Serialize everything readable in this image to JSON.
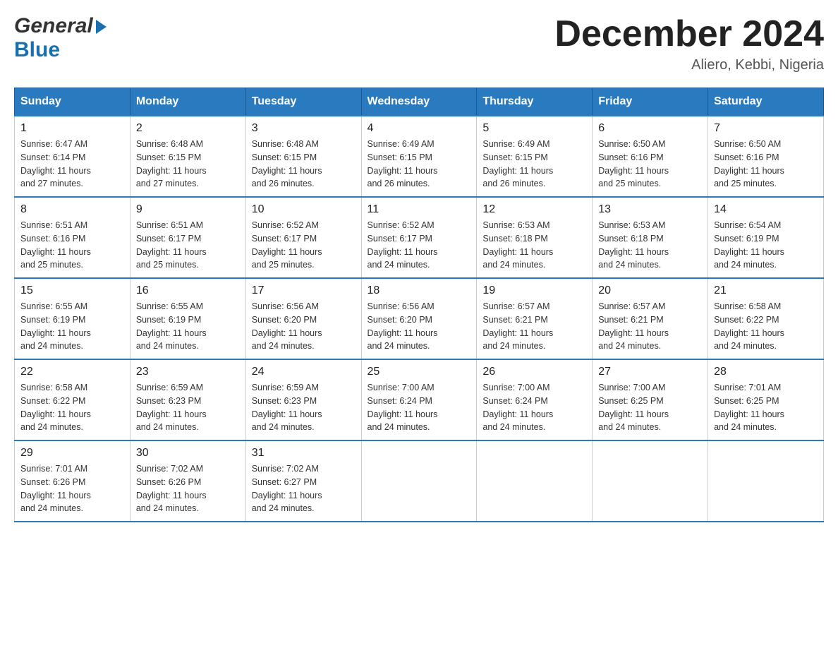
{
  "header": {
    "logo": {
      "general": "General",
      "blue": "Blue",
      "arrow": "▶"
    },
    "title": "December 2024",
    "location": "Aliero, Kebbi, Nigeria"
  },
  "weekdays": [
    "Sunday",
    "Monday",
    "Tuesday",
    "Wednesday",
    "Thursday",
    "Friday",
    "Saturday"
  ],
  "weeks": [
    [
      {
        "day": "1",
        "sunrise": "6:47 AM",
        "sunset": "6:14 PM",
        "daylight": "11 hours and 27 minutes."
      },
      {
        "day": "2",
        "sunrise": "6:48 AM",
        "sunset": "6:15 PM",
        "daylight": "11 hours and 27 minutes."
      },
      {
        "day": "3",
        "sunrise": "6:48 AM",
        "sunset": "6:15 PM",
        "daylight": "11 hours and 26 minutes."
      },
      {
        "day": "4",
        "sunrise": "6:49 AM",
        "sunset": "6:15 PM",
        "daylight": "11 hours and 26 minutes."
      },
      {
        "day": "5",
        "sunrise": "6:49 AM",
        "sunset": "6:15 PM",
        "daylight": "11 hours and 26 minutes."
      },
      {
        "day": "6",
        "sunrise": "6:50 AM",
        "sunset": "6:16 PM",
        "daylight": "11 hours and 25 minutes."
      },
      {
        "day": "7",
        "sunrise": "6:50 AM",
        "sunset": "6:16 PM",
        "daylight": "11 hours and 25 minutes."
      }
    ],
    [
      {
        "day": "8",
        "sunrise": "6:51 AM",
        "sunset": "6:16 PM",
        "daylight": "11 hours and 25 minutes."
      },
      {
        "day": "9",
        "sunrise": "6:51 AM",
        "sunset": "6:17 PM",
        "daylight": "11 hours and 25 minutes."
      },
      {
        "day": "10",
        "sunrise": "6:52 AM",
        "sunset": "6:17 PM",
        "daylight": "11 hours and 25 minutes."
      },
      {
        "day": "11",
        "sunrise": "6:52 AM",
        "sunset": "6:17 PM",
        "daylight": "11 hours and 24 minutes."
      },
      {
        "day": "12",
        "sunrise": "6:53 AM",
        "sunset": "6:18 PM",
        "daylight": "11 hours and 24 minutes."
      },
      {
        "day": "13",
        "sunrise": "6:53 AM",
        "sunset": "6:18 PM",
        "daylight": "11 hours and 24 minutes."
      },
      {
        "day": "14",
        "sunrise": "6:54 AM",
        "sunset": "6:19 PM",
        "daylight": "11 hours and 24 minutes."
      }
    ],
    [
      {
        "day": "15",
        "sunrise": "6:55 AM",
        "sunset": "6:19 PM",
        "daylight": "11 hours and 24 minutes."
      },
      {
        "day": "16",
        "sunrise": "6:55 AM",
        "sunset": "6:19 PM",
        "daylight": "11 hours and 24 minutes."
      },
      {
        "day": "17",
        "sunrise": "6:56 AM",
        "sunset": "6:20 PM",
        "daylight": "11 hours and 24 minutes."
      },
      {
        "day": "18",
        "sunrise": "6:56 AM",
        "sunset": "6:20 PM",
        "daylight": "11 hours and 24 minutes."
      },
      {
        "day": "19",
        "sunrise": "6:57 AM",
        "sunset": "6:21 PM",
        "daylight": "11 hours and 24 minutes."
      },
      {
        "day": "20",
        "sunrise": "6:57 AM",
        "sunset": "6:21 PM",
        "daylight": "11 hours and 24 minutes."
      },
      {
        "day": "21",
        "sunrise": "6:58 AM",
        "sunset": "6:22 PM",
        "daylight": "11 hours and 24 minutes."
      }
    ],
    [
      {
        "day": "22",
        "sunrise": "6:58 AM",
        "sunset": "6:22 PM",
        "daylight": "11 hours and 24 minutes."
      },
      {
        "day": "23",
        "sunrise": "6:59 AM",
        "sunset": "6:23 PM",
        "daylight": "11 hours and 24 minutes."
      },
      {
        "day": "24",
        "sunrise": "6:59 AM",
        "sunset": "6:23 PM",
        "daylight": "11 hours and 24 minutes."
      },
      {
        "day": "25",
        "sunrise": "7:00 AM",
        "sunset": "6:24 PM",
        "daylight": "11 hours and 24 minutes."
      },
      {
        "day": "26",
        "sunrise": "7:00 AM",
        "sunset": "6:24 PM",
        "daylight": "11 hours and 24 minutes."
      },
      {
        "day": "27",
        "sunrise": "7:00 AM",
        "sunset": "6:25 PM",
        "daylight": "11 hours and 24 minutes."
      },
      {
        "day": "28",
        "sunrise": "7:01 AM",
        "sunset": "6:25 PM",
        "daylight": "11 hours and 24 minutes."
      }
    ],
    [
      {
        "day": "29",
        "sunrise": "7:01 AM",
        "sunset": "6:26 PM",
        "daylight": "11 hours and 24 minutes."
      },
      {
        "day": "30",
        "sunrise": "7:02 AM",
        "sunset": "6:26 PM",
        "daylight": "11 hours and 24 minutes."
      },
      {
        "day": "31",
        "sunrise": "7:02 AM",
        "sunset": "6:27 PM",
        "daylight": "11 hours and 24 minutes."
      },
      null,
      null,
      null,
      null
    ]
  ],
  "labels": {
    "sunrise": "Sunrise:",
    "sunset": "Sunset:",
    "daylight": "Daylight:"
  }
}
